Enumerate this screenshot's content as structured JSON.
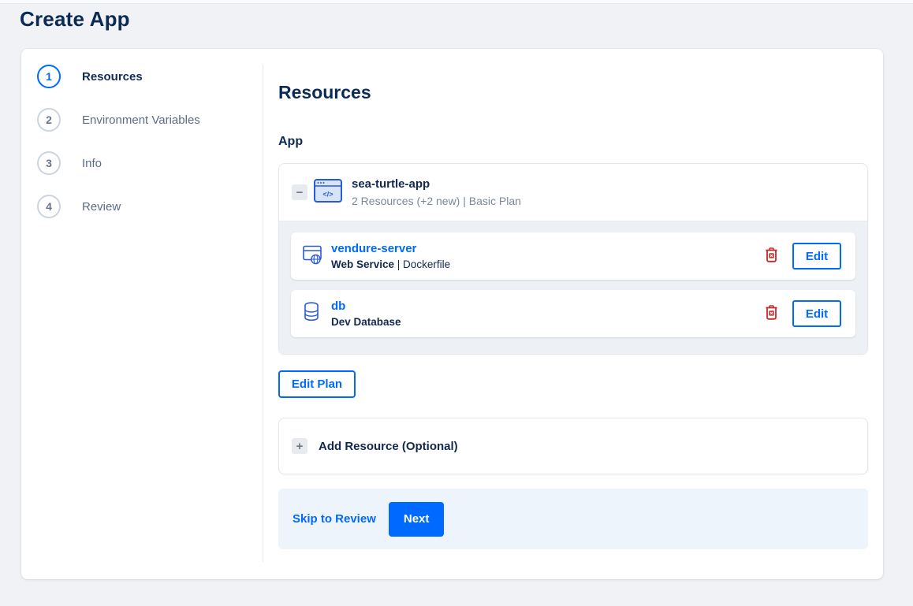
{
  "page": {
    "title": "Create App"
  },
  "colors": {
    "accent": "#0069ff",
    "navy": "#0b2b55",
    "danger": "#c62828",
    "page_bg": "#f0f2f6",
    "footer_bg": "#edf4fc"
  },
  "stepper": {
    "steps": [
      {
        "number": "1",
        "label": "Resources",
        "active": true
      },
      {
        "number": "2",
        "label": "Environment Variables",
        "active": false
      },
      {
        "number": "3",
        "label": "Info",
        "active": false
      },
      {
        "number": "4",
        "label": "Review",
        "active": false
      }
    ]
  },
  "content": {
    "heading": "Resources",
    "section_label": "App",
    "app_group": {
      "collapse_icon": "minus",
      "name": "sea-turtle-app",
      "summary": "2 Resources (+2 new) | Basic Plan",
      "resources": [
        {
          "name": "vendure-server",
          "type_bold": "Web Service",
          "type_rest": " | Dockerfile",
          "icon": "web-service-icon",
          "delete_icon": "trash",
          "edit_label": "Edit"
        },
        {
          "name": "db",
          "type_bold": "Dev Database",
          "type_rest": "",
          "icon": "database-icon",
          "delete_icon": "trash",
          "edit_label": "Edit"
        }
      ]
    },
    "edit_plan_label": "Edit Plan",
    "add_resource_label": "Add Resource (Optional)",
    "footer": {
      "skip_label": "Skip to Review",
      "next_label": "Next"
    }
  }
}
